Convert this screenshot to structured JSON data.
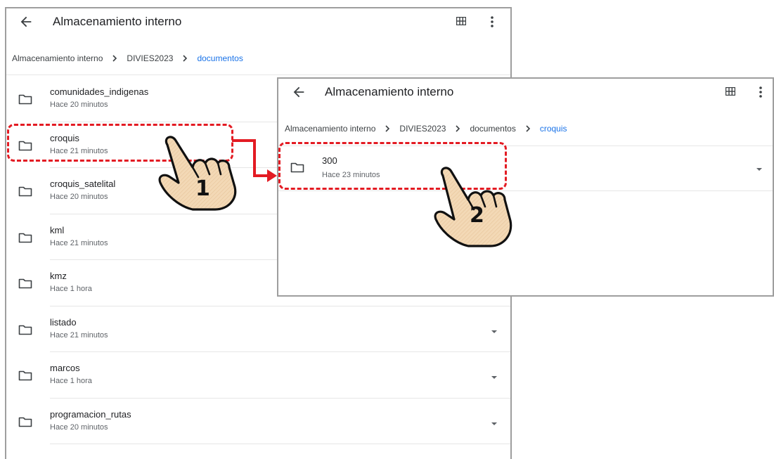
{
  "left_window": {
    "title": "Almacenamiento interno",
    "breadcrumb": [
      "Almacenamiento interno",
      "DIVIES2023",
      "documentos"
    ],
    "items": [
      {
        "name": "comunidades_indigenas",
        "modified": "Hace 20 minutos"
      },
      {
        "name": "croquis",
        "modified": "Hace 21 minutos"
      },
      {
        "name": "croquis_satelital",
        "modified": "Hace 20 minutos"
      },
      {
        "name": "kml",
        "modified": "Hace 21 minutos"
      },
      {
        "name": "kmz",
        "modified": "Hace 1 hora"
      },
      {
        "name": "listado",
        "modified": "Hace 21 minutos"
      },
      {
        "name": "marcos",
        "modified": "Hace 1 hora"
      },
      {
        "name": "programacion_rutas",
        "modified": "Hace 20 minutos"
      }
    ]
  },
  "right_window": {
    "title": "Almacenamiento interno",
    "breadcrumb": [
      "Almacenamiento interno",
      "DIVIES2023",
      "documentos",
      "croquis"
    ],
    "items": [
      {
        "name": "300",
        "modified": "Hace 23 minutos"
      }
    ]
  },
  "annotations": {
    "step_1": "1",
    "step_2": "2",
    "highlight_color": "#e31b23"
  },
  "icons": {
    "back": "arrow-left-icon",
    "view": "grid-view-icon",
    "menu": "more-vert-icon",
    "folder": "folder-icon",
    "expand": "caret-down-icon"
  }
}
